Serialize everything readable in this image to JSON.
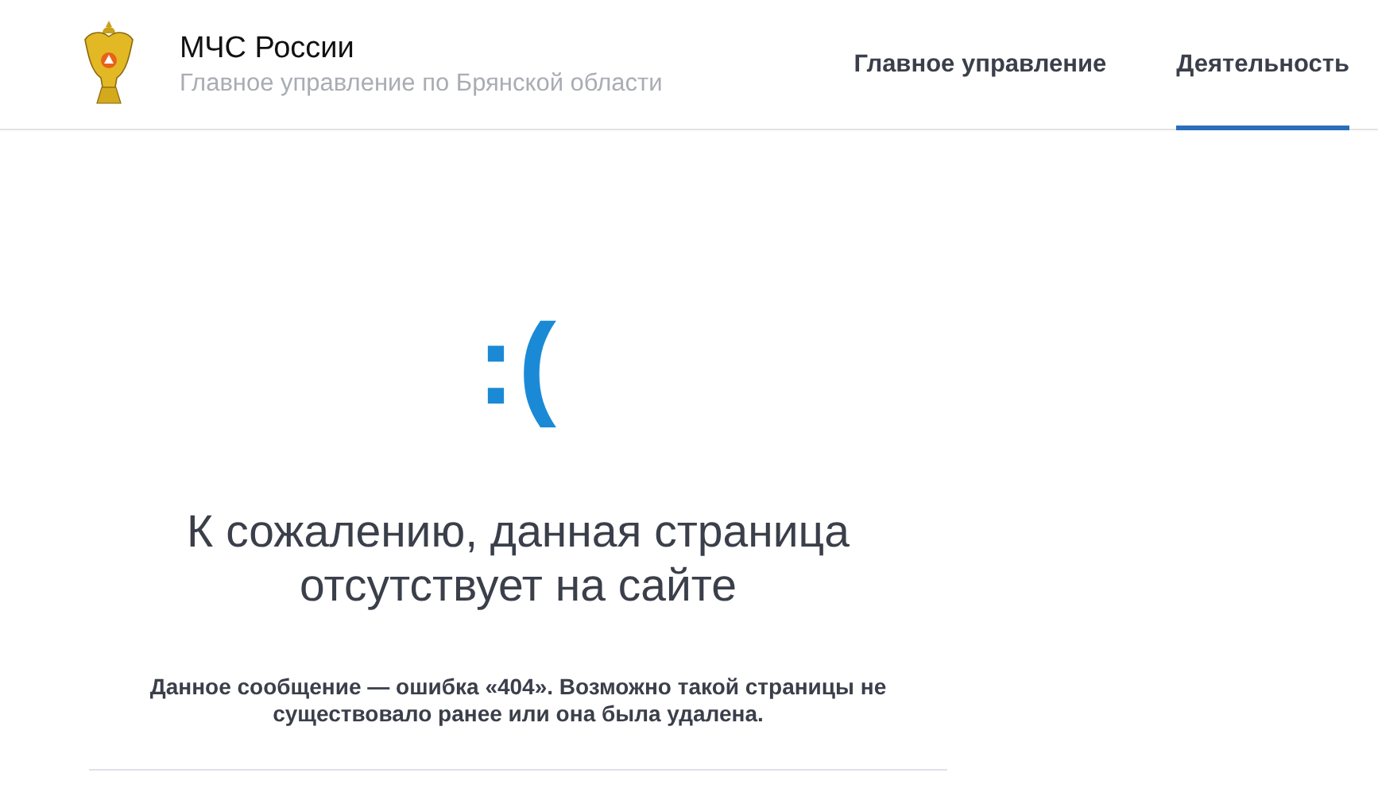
{
  "header": {
    "title": "МЧС России",
    "subtitle": "Главное управление по Брянской области"
  },
  "nav": [
    {
      "label": "Главное управление",
      "selected": false
    },
    {
      "label": "Деятельность",
      "selected": true
    }
  ],
  "error": {
    "face": ":(",
    "heading": "К сожалению, данная страница отсутствует на сайте",
    "message": "Данное сообщение — ошибка «404». Возможно такой страницы не существовало ранее или она была удалена."
  }
}
